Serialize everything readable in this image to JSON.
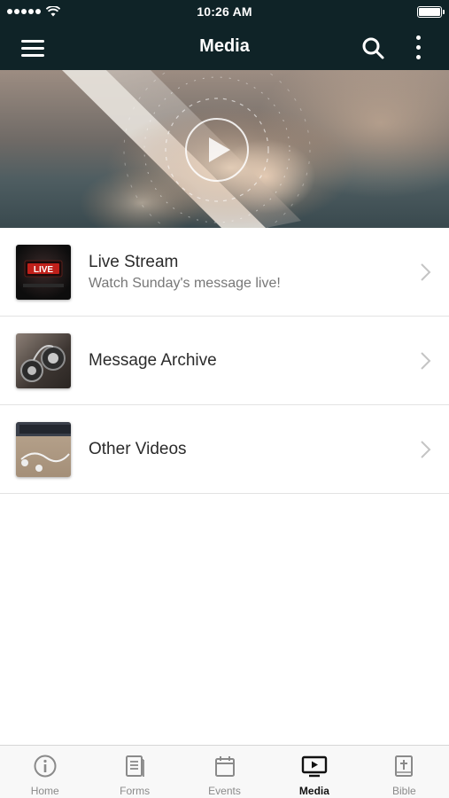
{
  "status_bar": {
    "time": "10:26 AM"
  },
  "nav_bar": {
    "title": "Media"
  },
  "media_items": [
    {
      "title": "Live Stream",
      "subtitle": "Watch Sunday's message live!",
      "thumb_label": "LIVE"
    },
    {
      "title": "Message Archive",
      "subtitle": ""
    },
    {
      "title": "Other Videos",
      "subtitle": ""
    }
  ],
  "tab_bar": {
    "tabs": [
      {
        "label": "Home",
        "icon": "info-icon"
      },
      {
        "label": "Forms",
        "icon": "forms-icon"
      },
      {
        "label": "Events",
        "icon": "calendar-icon"
      },
      {
        "label": "Media",
        "icon": "play-screen-icon",
        "active": true
      },
      {
        "label": "Bible",
        "icon": "bible-icon"
      }
    ]
  },
  "colors": {
    "header_bg": "#0f2327",
    "tab_active": "#111111",
    "tab_inactive": "#8a8a8a",
    "live_badge": "#c0201a"
  }
}
